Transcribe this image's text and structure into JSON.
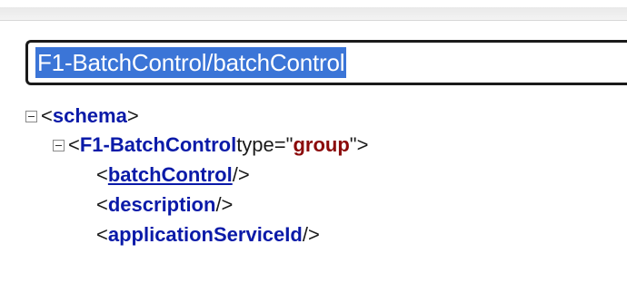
{
  "search": {
    "value": "F1-BatchControl/batchControl"
  },
  "tree": {
    "root": {
      "open": "<",
      "tag": "schema",
      "close": ">"
    },
    "group": {
      "open": "<",
      "tag": "F1-BatchControl",
      "attr_text": " type=\"",
      "attr_value": "group",
      "attr_close": "\">"
    },
    "children": [
      {
        "open": "<",
        "tag": "batchControl",
        "close": "/>",
        "linked": true
      },
      {
        "open": "<",
        "tag": "description",
        "close": "/>",
        "linked": false
      },
      {
        "open": "<",
        "tag": "applicationServiceId",
        "close": "/>",
        "linked": false
      }
    ]
  },
  "icons": {
    "toggle": "collapse-minus-icon"
  },
  "colors": {
    "tag": "#0a1aa8",
    "attr_value": "#8b0a0a",
    "selection": "#3b75d7"
  }
}
